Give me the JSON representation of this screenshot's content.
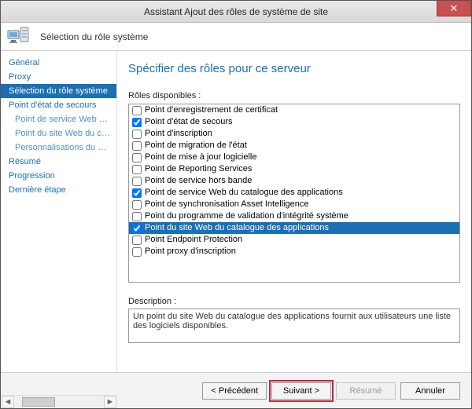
{
  "window": {
    "title": "Assistant Ajout des rôles de système de site"
  },
  "header": {
    "subtitle": "Sélection du rôle système"
  },
  "sidebar": {
    "items": [
      {
        "label": "Général",
        "active": false,
        "indent": 0
      },
      {
        "label": "Proxy",
        "active": false,
        "indent": 0
      },
      {
        "label": "Sélection du rôle système",
        "active": true,
        "indent": 0
      },
      {
        "label": "Point d'état de secours",
        "active": false,
        "indent": 0
      },
      {
        "label": "Point de service Web du c…",
        "active": false,
        "indent": 1
      },
      {
        "label": "Point du site Web du cata…",
        "active": false,
        "indent": 1
      },
      {
        "label": "Personnalisations du cata…",
        "active": false,
        "indent": 1
      },
      {
        "label": "Résumé",
        "active": false,
        "indent": 0
      },
      {
        "label": "Progression",
        "active": false,
        "indent": 0
      },
      {
        "label": "Dernière étape",
        "active": false,
        "indent": 0
      }
    ]
  },
  "main": {
    "title": "Spécifier des rôles pour ce serveur",
    "roles_label": "Rôles disponibles :",
    "roles": [
      {
        "label": "Point d'enregistrement de certificat",
        "checked": false,
        "selected": false
      },
      {
        "label": "Point d'état de secours",
        "checked": true,
        "selected": false
      },
      {
        "label": "Point d'inscription",
        "checked": false,
        "selected": false
      },
      {
        "label": "Point de migration de l'état",
        "checked": false,
        "selected": false
      },
      {
        "label": "Point de mise à jour logicielle",
        "checked": false,
        "selected": false
      },
      {
        "label": "Point de Reporting Services",
        "checked": false,
        "selected": false
      },
      {
        "label": "Point de service hors bande",
        "checked": false,
        "selected": false
      },
      {
        "label": "Point de service Web du catalogue des applications",
        "checked": true,
        "selected": false
      },
      {
        "label": "Point de synchronisation Asset Intelligence",
        "checked": false,
        "selected": false
      },
      {
        "label": "Point du programme de validation d'intégrité système",
        "checked": false,
        "selected": false
      },
      {
        "label": "Point du site Web du catalogue des applications",
        "checked": true,
        "selected": true
      },
      {
        "label": "Point Endpoint Protection",
        "checked": false,
        "selected": false
      },
      {
        "label": "Point proxy d'inscription",
        "checked": false,
        "selected": false
      }
    ],
    "description_label": "Description :",
    "description_text": "Un point du site Web du catalogue des applications fournit aux utilisateurs une liste des logiciels disponibles."
  },
  "footer": {
    "previous": "< Précédent",
    "next": "Suivant >",
    "summary": "Résumé",
    "cancel": "Annuler"
  }
}
